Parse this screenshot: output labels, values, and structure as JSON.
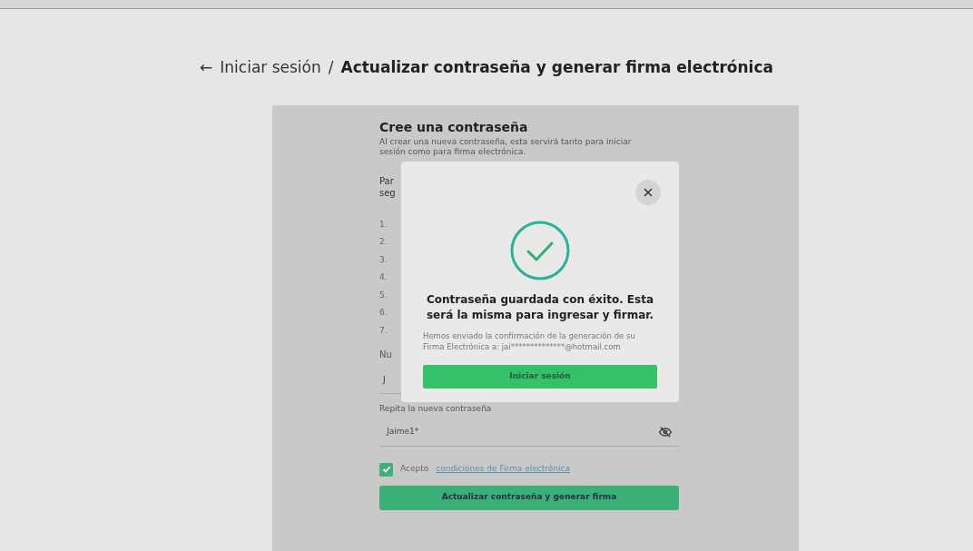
{
  "breadcrumb": {
    "back_icon_text": "←",
    "parent": "Iniciar sesión",
    "separator": "/",
    "current": "Actualizar contraseña y generar firma electrónica"
  },
  "form": {
    "title": "Cree una contraseña",
    "description": "Al crear una nueva contraseña, esta servirá tanto para iniciar sesión como para firma electrónica.",
    "partial_lines": [
      "Par",
      "seg"
    ],
    "list_numbers": [
      "1.",
      "2.",
      "3.",
      "4.",
      "5.",
      "6.",
      "7."
    ],
    "new_password": {
      "label": "Nu",
      "value": "J"
    },
    "repeat_password": {
      "label": "Repita la nueva contraseña",
      "value": "Jaime1*",
      "visible": true
    },
    "terms": {
      "checked": true,
      "text": "Acepto",
      "link": "condiciones de Firma electrónica"
    },
    "submit": "Actualizar contraseña y generar firma"
  },
  "modal": {
    "title": "Contraseña guardada con éxito. Esta será la misma para ingresar y firmar.",
    "message": "Hemos enviado la confirmación de la generación de su Firma Electrónica a: jai**************@hotmail.com",
    "button": "Iniciar sesión"
  }
}
